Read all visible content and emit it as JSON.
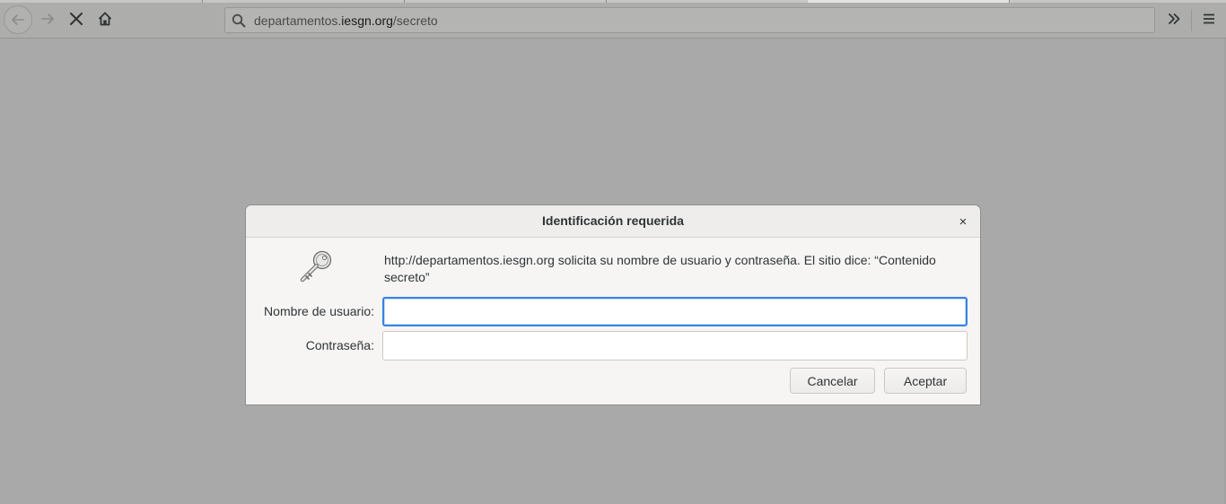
{
  "browser": {
    "url_prefix": "departamentos.",
    "url_domain": "iesgn.org",
    "url_path": "/secreto"
  },
  "icons": {
    "back": "back-arrow-icon",
    "forward": "forward-arrow-icon",
    "stop": "stop-icon",
    "home": "home-icon",
    "search": "search-icon",
    "overflow": "chevron-double-right-icon",
    "menu": "hamburger-menu-icon",
    "key": "key-icon",
    "close": "close-icon"
  },
  "dialog": {
    "title": "Identificación requerida",
    "close_glyph": "×",
    "message": "http://departamentos.iesgn.org solicita su nombre de usuario y contraseña. El sitio dice: “Contenido secreto”",
    "username_label": "Nombre de usuario:",
    "username_value": "",
    "password_label": "Contraseña:",
    "password_value": "",
    "cancel_label": "Cancelar",
    "accept_label": "Aceptar"
  },
  "colors": {
    "focus_ring": "#3584e4",
    "overlay_bg": "#a9a9a9",
    "dialog_bg": "#f6f5f4"
  }
}
